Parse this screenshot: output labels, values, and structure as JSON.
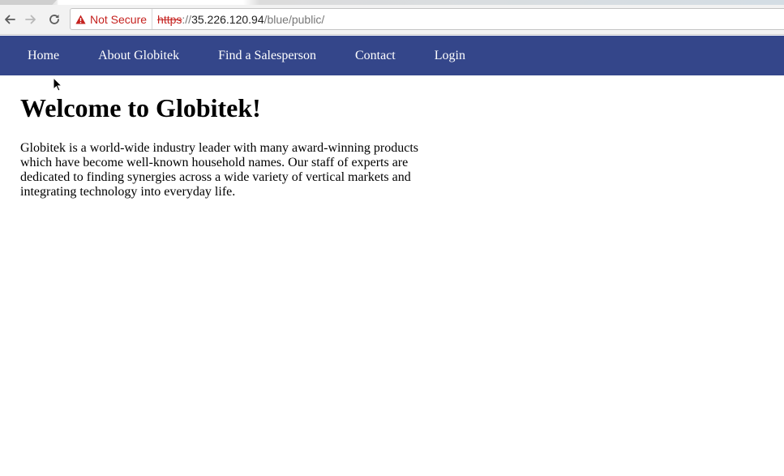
{
  "browser": {
    "back_icon": "arrow-left-icon",
    "forward_icon": "arrow-right-icon",
    "reload_icon": "reload-icon",
    "security_icon": "warning-triangle-icon",
    "security_label": "Not Secure",
    "security_color": "#c5221f",
    "url": {
      "scheme": "https",
      "separator": "://",
      "host": "35.226.120.94",
      "path": "/blue/public/"
    }
  },
  "site": {
    "nav_color": "#34468a",
    "nav": [
      {
        "label": "Home"
      },
      {
        "label": "About Globitek"
      },
      {
        "label": "Find a Salesperson"
      },
      {
        "label": "Contact"
      },
      {
        "label": "Login"
      }
    ],
    "title": "Welcome to Globitek!",
    "intro": "Globitek is a world-wide industry leader with many award-winning products which have become well-known household names. Our staff of experts are dedicated to finding synergies across a wide variety of vertical markets and integrating technology into everyday life."
  }
}
